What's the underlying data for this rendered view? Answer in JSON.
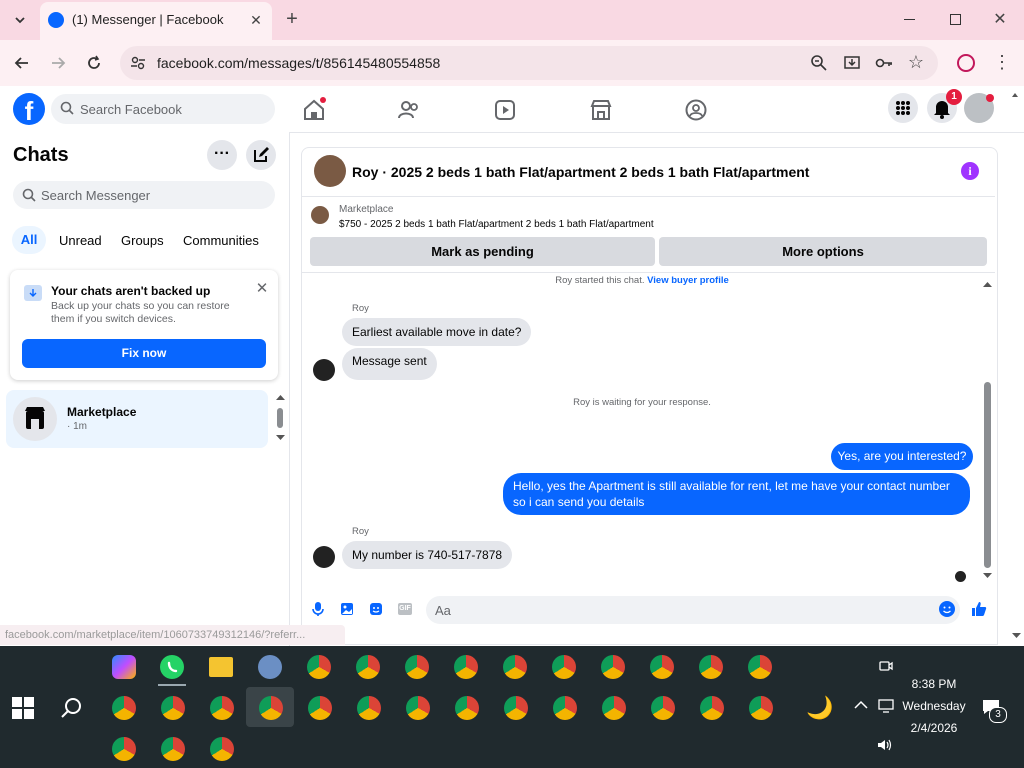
{
  "browser": {
    "tab_title": "(1) Messenger | Facebook",
    "url": "facebook.com/messages/t/856145480554858",
    "status_url": "facebook.com/marketplace/item/1060733749312146/?referr..."
  },
  "fb": {
    "search_placeholder": "Search Facebook",
    "notification_count": "1"
  },
  "sidebar": {
    "title": "Chats",
    "search_placeholder": "Search Messenger",
    "filters": [
      "All",
      "Unread",
      "Groups",
      "Communities"
    ],
    "backup": {
      "title": "Your chats aren't backed up",
      "description": "Back up your chats so you can restore them if you switch devices.",
      "button": "Fix now"
    },
    "chats": [
      {
        "name": "Marketplace",
        "time": "· 1m"
      }
    ]
  },
  "conversation": {
    "title": "Roy · 2025 2 beds 1 bath Flat/apartment 2 beds 1 bath Flat/apartment",
    "listing": {
      "label": "Marketplace",
      "price_title": "$750 - 2025 2 beds 1 bath Flat/apartment 2 beds 1 bath Flat/apartment"
    },
    "actions": {
      "pending": "Mark as pending",
      "more": "More options"
    },
    "started_text": "Roy started this chat.",
    "buyer_profile_link": "View buyer profile",
    "sender_name": "Roy",
    "msg_in_1": "Earliest available move in date?",
    "msg_in_2": "Message sent",
    "waiting_text": "Roy is waiting for your response.",
    "msg_out_1": "Yes, are you interested?",
    "msg_out_2": "Hello, yes the Apartment is still available for rent, let me have your contact number so i can send you details",
    "msg_in_3": "My number is 740-517-7878",
    "composer_placeholder": "Aa"
  },
  "taskbar": {
    "time": "8:38 PM",
    "day": "Wednesday",
    "date": "2/4/2026",
    "notification_count": "3"
  },
  "colors": {
    "fb_blue": "#0866ff",
    "tabstrip": "#f9d9e3",
    "taskbar": "#202a2e",
    "info_purple": "#a033ff"
  }
}
